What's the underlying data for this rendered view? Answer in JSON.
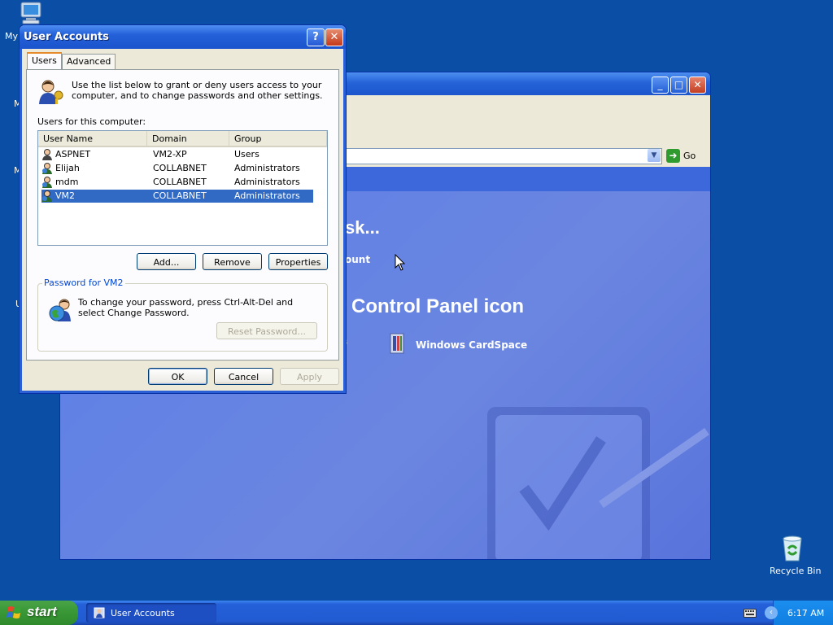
{
  "desktop": {
    "my_computer_label": "My",
    "edge_letters": [
      "M",
      "M",
      "U"
    ],
    "recycle_bin_label": "Recycle Bin"
  },
  "background_window": {
    "address_go": "Go",
    "heading_pick_task": "sk...",
    "link_account": "ount",
    "heading_control_panel": "Control Panel icon",
    "cardspace_label": "Windows CardSpace",
    "partial_text": "s"
  },
  "dialog": {
    "title": "User Accounts",
    "help_button": "?",
    "close_button": "✕",
    "tabs": [
      {
        "label": "Users",
        "active": true
      },
      {
        "label": "Advanced",
        "active": false
      }
    ],
    "intro_text": "Use the list below to grant or deny users access to your computer, and to change passwords and other settings.",
    "users_label": "Users for this computer:",
    "columns": [
      "User Name",
      "Domain",
      "Group"
    ],
    "rows": [
      {
        "name": "ASPNET",
        "domain": "VM2-XP",
        "group": "Users",
        "selected": false
      },
      {
        "name": "Elijah",
        "domain": "COLLABNET",
        "group": "Administrators",
        "selected": false
      },
      {
        "name": "mdm",
        "domain": "COLLABNET",
        "group": "Administrators",
        "selected": false
      },
      {
        "name": "VM2",
        "domain": "COLLABNET",
        "group": "Administrators",
        "selected": true
      }
    ],
    "buttons": {
      "add": "Add...",
      "remove": "Remove",
      "properties": "Properties"
    },
    "password_group": {
      "title": "Password for VM2",
      "text": "To change your password, press Ctrl-Alt-Del and select Change Password.",
      "reset_button": "Reset Password..."
    },
    "footer": {
      "ok": "OK",
      "cancel": "Cancel",
      "apply": "Apply"
    }
  },
  "taskbar": {
    "start_label": "start",
    "task_button": "User Accounts",
    "clock": "6:17 AM"
  },
  "colors": {
    "desktop": "#0a4ea6",
    "selection": "#316ac5",
    "start_green": "#3b9938"
  }
}
